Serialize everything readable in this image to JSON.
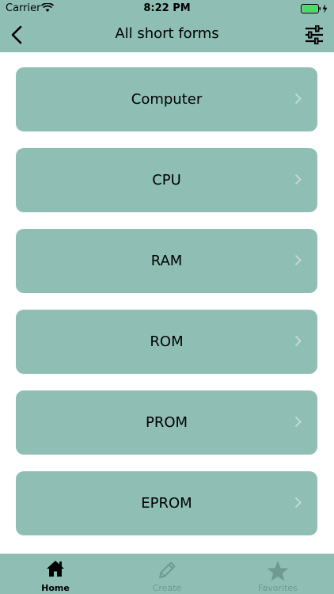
{
  "status": {
    "carrier": "Carrier",
    "time": "8:22 PM"
  },
  "nav": {
    "title": "All short forms"
  },
  "items": [
    {
      "label": "Computer"
    },
    {
      "label": "CPU"
    },
    {
      "label": "RAM"
    },
    {
      "label": "ROM"
    },
    {
      "label": "PROM"
    },
    {
      "label": "EPROM"
    }
  ],
  "tabs": [
    {
      "label": "Home",
      "icon": "home-icon"
    },
    {
      "label": "Create",
      "icon": "pencil-icon"
    },
    {
      "label": "Favorites",
      "icon": "star-icon"
    }
  ],
  "colors": {
    "accent": "#8fbfb4",
    "inactive_tab": "#6f9a91",
    "battery": "#4cd964"
  }
}
